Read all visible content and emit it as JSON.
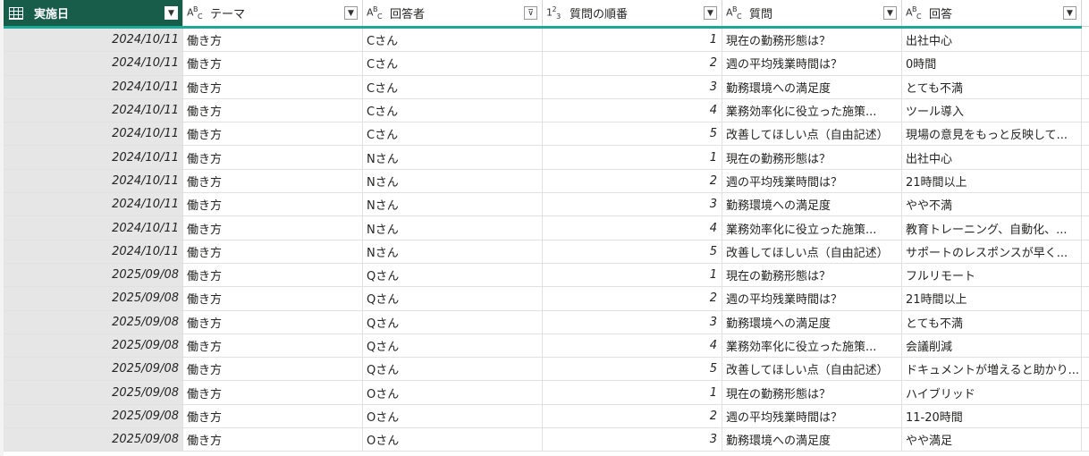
{
  "columns": [
    {
      "label": "実施日",
      "type_icon": "table-icon"
    },
    {
      "label": "テーマ",
      "type_icon": "ABC"
    },
    {
      "label": "回答者",
      "type_icon": "ABC",
      "filtered": true
    },
    {
      "label": "質問の順番",
      "type_icon": "123"
    },
    {
      "label": "質問",
      "type_icon": "ABC"
    },
    {
      "label": "回答",
      "type_icon": "ABC"
    }
  ],
  "colors": {
    "selected_header": "#185c4a",
    "accent_bar": "#1ea896"
  },
  "rows": [
    {
      "date": "2024/10/11",
      "theme": "働き方",
      "respondent": "Cさん",
      "order": "1",
      "question": "現在の勤務形態は？",
      "answer": "出社中心"
    },
    {
      "date": "2024/10/11",
      "theme": "働き方",
      "respondent": "Cさん",
      "order": "2",
      "question": "週の平均残業時間は？",
      "answer": "0時間"
    },
    {
      "date": "2024/10/11",
      "theme": "働き方",
      "respondent": "Cさん",
      "order": "3",
      "question": "勤務環境への満足度",
      "answer": "とても不満"
    },
    {
      "date": "2024/10/11",
      "theme": "働き方",
      "respondent": "Cさん",
      "order": "4",
      "question": "業務効率化に役立った施策...",
      "answer": "ツール導入"
    },
    {
      "date": "2024/10/11",
      "theme": "働き方",
      "respondent": "Cさん",
      "order": "5",
      "question": "改善してほしい点（自由記述）",
      "answer": "現場の意見をもっと反映して..."
    },
    {
      "date": "2024/10/11",
      "theme": "働き方",
      "respondent": "Nさん",
      "order": "1",
      "question": "現在の勤務形態は？",
      "answer": "出社中心"
    },
    {
      "date": "2024/10/11",
      "theme": "働き方",
      "respondent": "Nさん",
      "order": "2",
      "question": "週の平均残業時間は？",
      "answer": "21時間以上"
    },
    {
      "date": "2024/10/11",
      "theme": "働き方",
      "respondent": "Nさん",
      "order": "3",
      "question": "勤務環境への満足度",
      "answer": "やや不満"
    },
    {
      "date": "2024/10/11",
      "theme": "働き方",
      "respondent": "Nさん",
      "order": "4",
      "question": "業務効率化に役立った施策...",
      "answer": "教育トレーニング、自動化、..."
    },
    {
      "date": "2024/10/11",
      "theme": "働き方",
      "respondent": "Nさん",
      "order": "5",
      "question": "改善してほしい点（自由記述）",
      "answer": "サポートのレスポンスが早く..."
    },
    {
      "date": "2025/09/08",
      "theme": "働き方",
      "respondent": "Qさん",
      "order": "1",
      "question": "現在の勤務形態は？",
      "answer": "フルリモート"
    },
    {
      "date": "2025/09/08",
      "theme": "働き方",
      "respondent": "Qさん",
      "order": "2",
      "question": "週の平均残業時間は？",
      "answer": "21時間以上"
    },
    {
      "date": "2025/09/08",
      "theme": "働き方",
      "respondent": "Qさん",
      "order": "3",
      "question": "勤務環境への満足度",
      "answer": "とても不満"
    },
    {
      "date": "2025/09/08",
      "theme": "働き方",
      "respondent": "Qさん",
      "order": "4",
      "question": "業務効率化に役立った施策...",
      "answer": "会議削減"
    },
    {
      "date": "2025/09/08",
      "theme": "働き方",
      "respondent": "Qさん",
      "order": "5",
      "question": "改善してほしい点（自由記述）",
      "answer": "ドキュメントが増えると助かり..."
    },
    {
      "date": "2025/09/08",
      "theme": "働き方",
      "respondent": "Oさん",
      "order": "1",
      "question": "現在の勤務形態は？",
      "answer": "ハイブリッド"
    },
    {
      "date": "2025/09/08",
      "theme": "働き方",
      "respondent": "Oさん",
      "order": "2",
      "question": "週の平均残業時間は？",
      "answer": "11-20時間"
    },
    {
      "date": "2025/09/08",
      "theme": "働き方",
      "respondent": "Oさん",
      "order": "3",
      "question": "勤務環境への満足度",
      "answer": "やや満足"
    }
  ]
}
